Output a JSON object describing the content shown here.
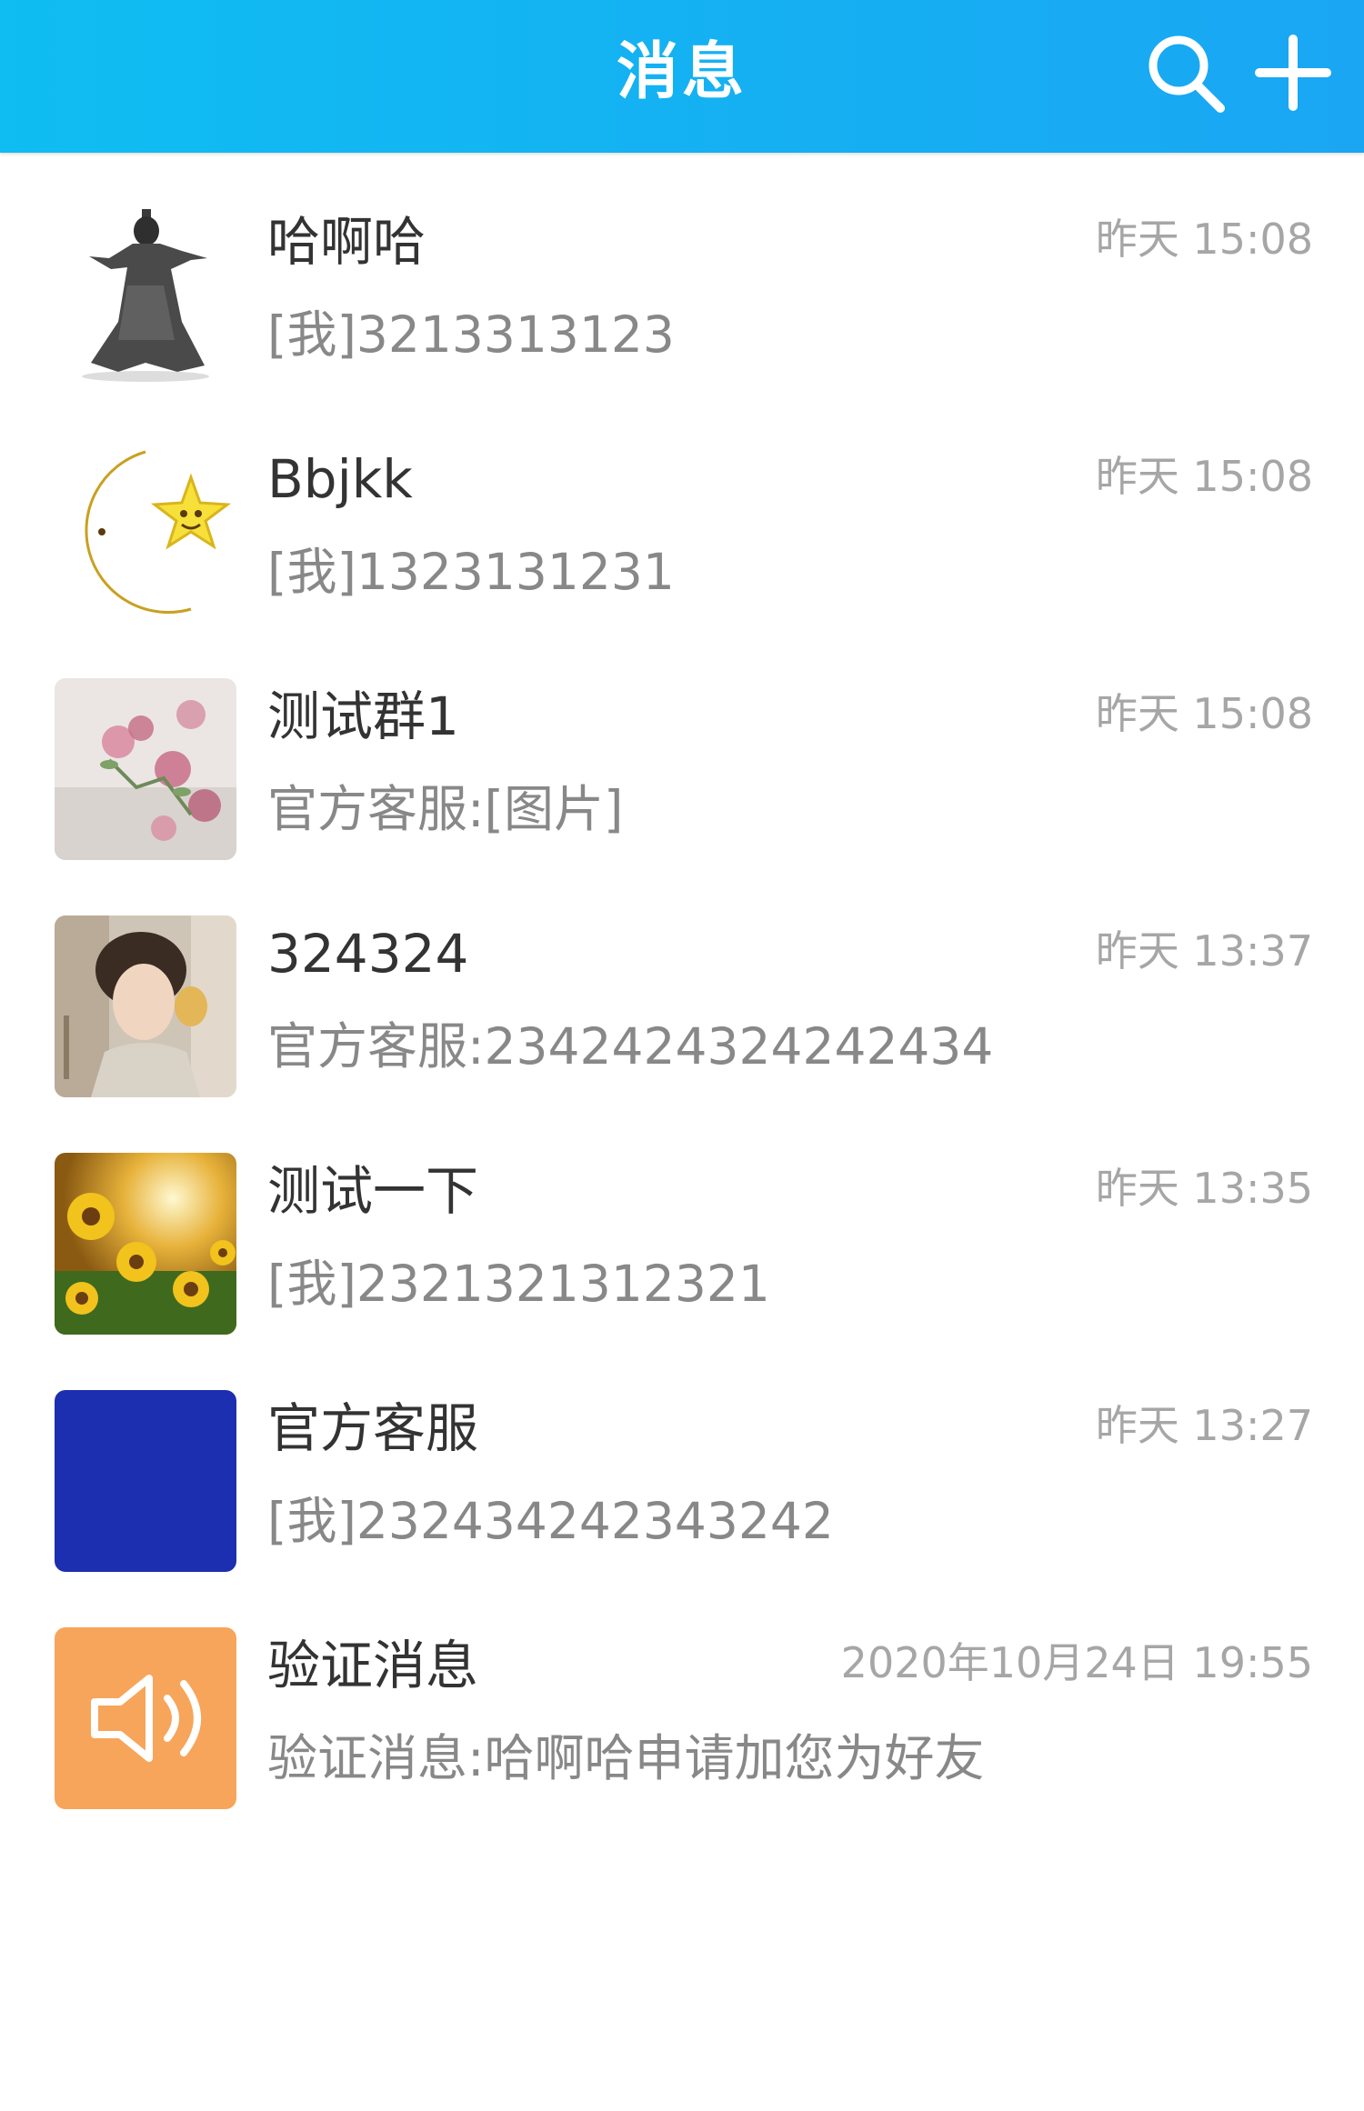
{
  "header": {
    "title": "消息",
    "search_icon": "search-icon",
    "add_icon": "plus-icon"
  },
  "conversations": [
    {
      "name": "哈啊哈",
      "time": "昨天 15:08",
      "preview": "[我]3213313123",
      "avatar": "avatar-ink-figure"
    },
    {
      "name": "Bbjkk",
      "time": "昨天 15:08",
      "preview": "[我]1323131231",
      "avatar": "avatar-moon-star"
    },
    {
      "name": "测试群1",
      "time": "昨天 15:08",
      "preview": "官方客服:[图片]",
      "avatar": "avatar-pink-flowers"
    },
    {
      "name": "324324",
      "time": "昨天 13:37",
      "preview": "官方客服:2342424324242434",
      "avatar": "avatar-person-photo"
    },
    {
      "name": "测试一下",
      "time": "昨天 13:35",
      "preview": "[我]2321321312321",
      "avatar": "avatar-sunflowers"
    },
    {
      "name": "官方客服",
      "time": "昨天 13:27",
      "preview": "[我]232434242343242",
      "avatar": "avatar-blue-square"
    },
    {
      "name": "验证消息",
      "time": "2020年10月24日 19:55",
      "preview": "验证消息:哈啊哈申请加您为好友",
      "avatar": "speaker-icon"
    }
  ],
  "colors": {
    "header_start": "#0fbdf2",
    "header_end": "#1aa6f3",
    "verify_avatar_bg": "#f7a55a",
    "service_avatar_bg": "#1c2fb0"
  }
}
